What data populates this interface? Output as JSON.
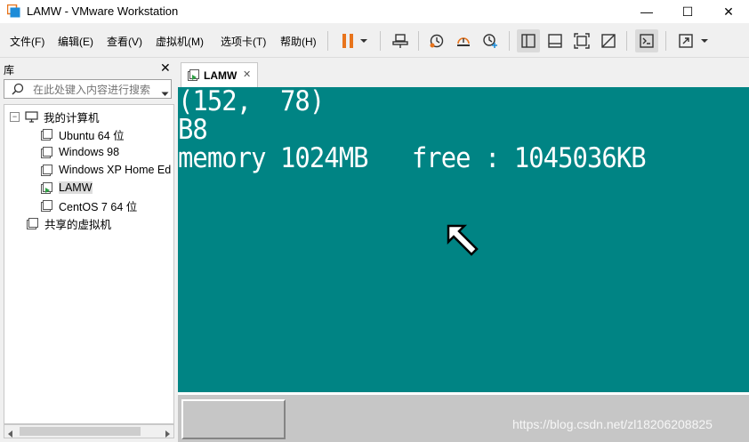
{
  "window": {
    "title": "LAMW - VMware Workstation",
    "minimize": "—",
    "maximize": "☐",
    "close": "✕"
  },
  "menu": [
    "文件(F)",
    "编辑(E)",
    "查看(V)",
    "虚拟机(M)",
    "选项卡(T)",
    "帮助(H)"
  ],
  "library": {
    "title": "库",
    "close": "✕",
    "search_placeholder": "在此处键入内容进行搜索",
    "tree": {
      "root": "我的计算机",
      "vms": [
        "Ubuntu 64 位",
        "Windows 98",
        "Windows XP Home Ed",
        "LAMW",
        "CentOS 7 64 位"
      ],
      "shared": "共享的虚拟机",
      "selected": "LAMW"
    }
  },
  "tabs": [
    {
      "label": "LAMW",
      "close": "✕"
    }
  ],
  "vm": {
    "lines": [
      "(152,  78)",
      "B8",
      "memory 1024MB   free : 1045036KB"
    ],
    "background": "#008484"
  },
  "watermark": "https://blog.csdn.net/zl18206208825",
  "colors": {
    "accent_orange": "#e8741c",
    "vm_teal": "#008484"
  }
}
